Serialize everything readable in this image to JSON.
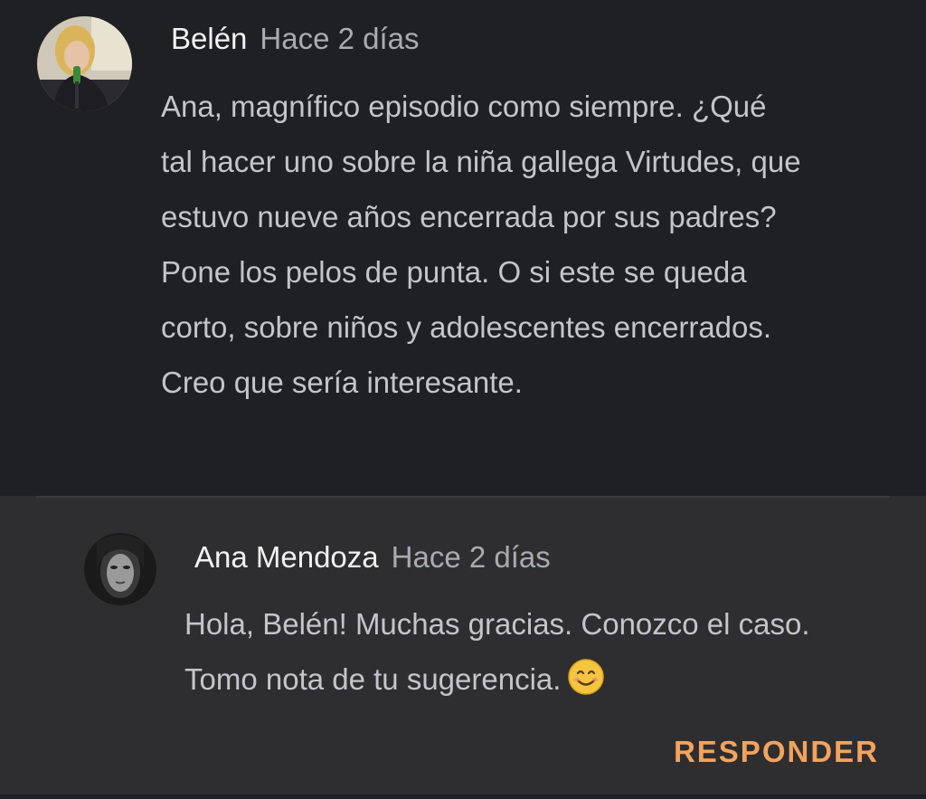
{
  "comment": {
    "author": "Belén",
    "time": "Hace 2 días",
    "body_lines": [
      "Ana, magnífico episodio como siempre. ¿Qué",
      "tal hacer uno sobre la niña gallega Virtudes, que",
      "estuvo nueve años encerrada por sus padres?",
      "Pone los pelos de punta. O si este se queda",
      "corto, sobre niños y adolescentes encerrados.",
      "Creo que sería interesante."
    ]
  },
  "reply": {
    "author": "Ana Mendoza",
    "time": "Hace 2 días",
    "body_lines": [
      "Hola, Belén! Muchas gracias. Conozco el caso.",
      "Tomo nota de tu sugerencia."
    ],
    "emoji_icon": "smiling-face-icon"
  },
  "actions": {
    "respond_label": "RESPONDER"
  },
  "colors": {
    "background": "#1f2024",
    "reply_background": "#2e2e30",
    "accent": "#f3a35c"
  }
}
